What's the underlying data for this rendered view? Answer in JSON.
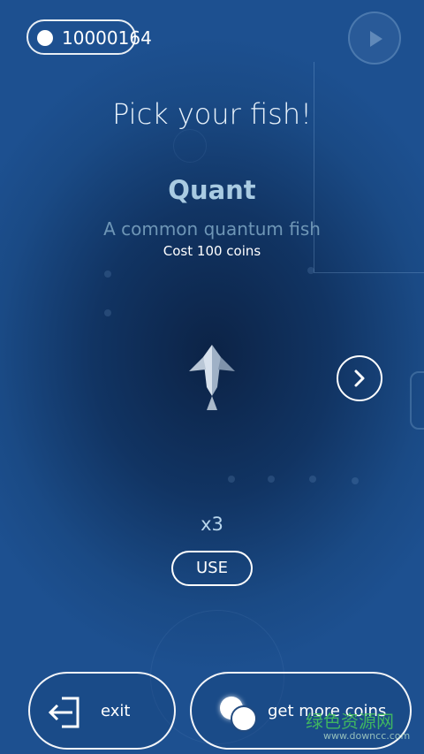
{
  "hud": {
    "coins": "10000164",
    "coin_icon": "coin-icon",
    "play_icon": "play-icon"
  },
  "heading": "Pick your fish!",
  "fish": {
    "name": "Quant",
    "description": "A common quantum fish",
    "cost": "Cost 100 coins",
    "multiplier": "x3",
    "next_icon": "chevron-right-icon"
  },
  "actions": {
    "use_label": "USE",
    "exit_label": "exit",
    "exit_icon": "exit-door-icon",
    "get_coins_label": "get more coins",
    "get_coins_icon": "coins-icon"
  },
  "watermark": {
    "text": "绿色资源网",
    "url": "www.downcc.com"
  },
  "colors": {
    "background_dark": "#0c2346",
    "background_light": "#1d5090",
    "fish_name": "#a9cbe2",
    "description": "#6e96b6",
    "accent": "#ffffff"
  }
}
